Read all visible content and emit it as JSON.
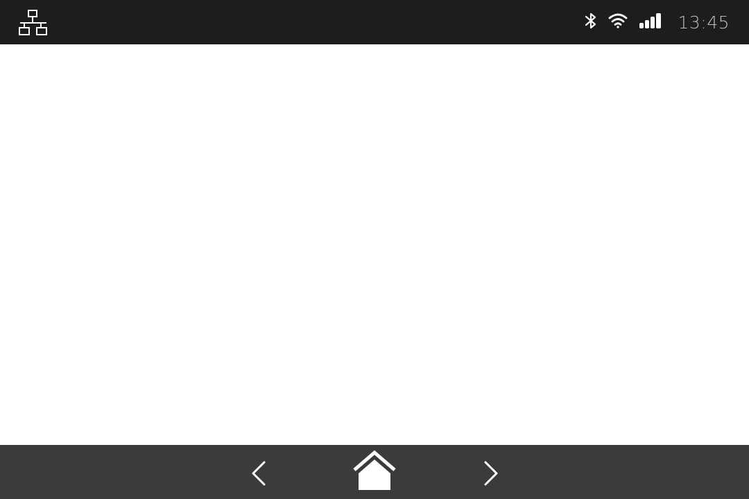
{
  "status_bar": {
    "network_icon": "wired-network-icon",
    "bluetooth_icon": "bluetooth-icon",
    "wifi_icon": "wifi-icon",
    "signal_icon": "cellular-signal-icon",
    "time": "13:45"
  },
  "navigation": {
    "back_icon": "chevron-left-icon",
    "home_icon": "home-icon",
    "forward_icon": "chevron-right-icon"
  },
  "colors": {
    "status_bar_bg": "#1d1d1d",
    "nav_bar_bg": "#3b3b3b",
    "icon": "#ffffff",
    "content_bg": "#ffffff"
  }
}
